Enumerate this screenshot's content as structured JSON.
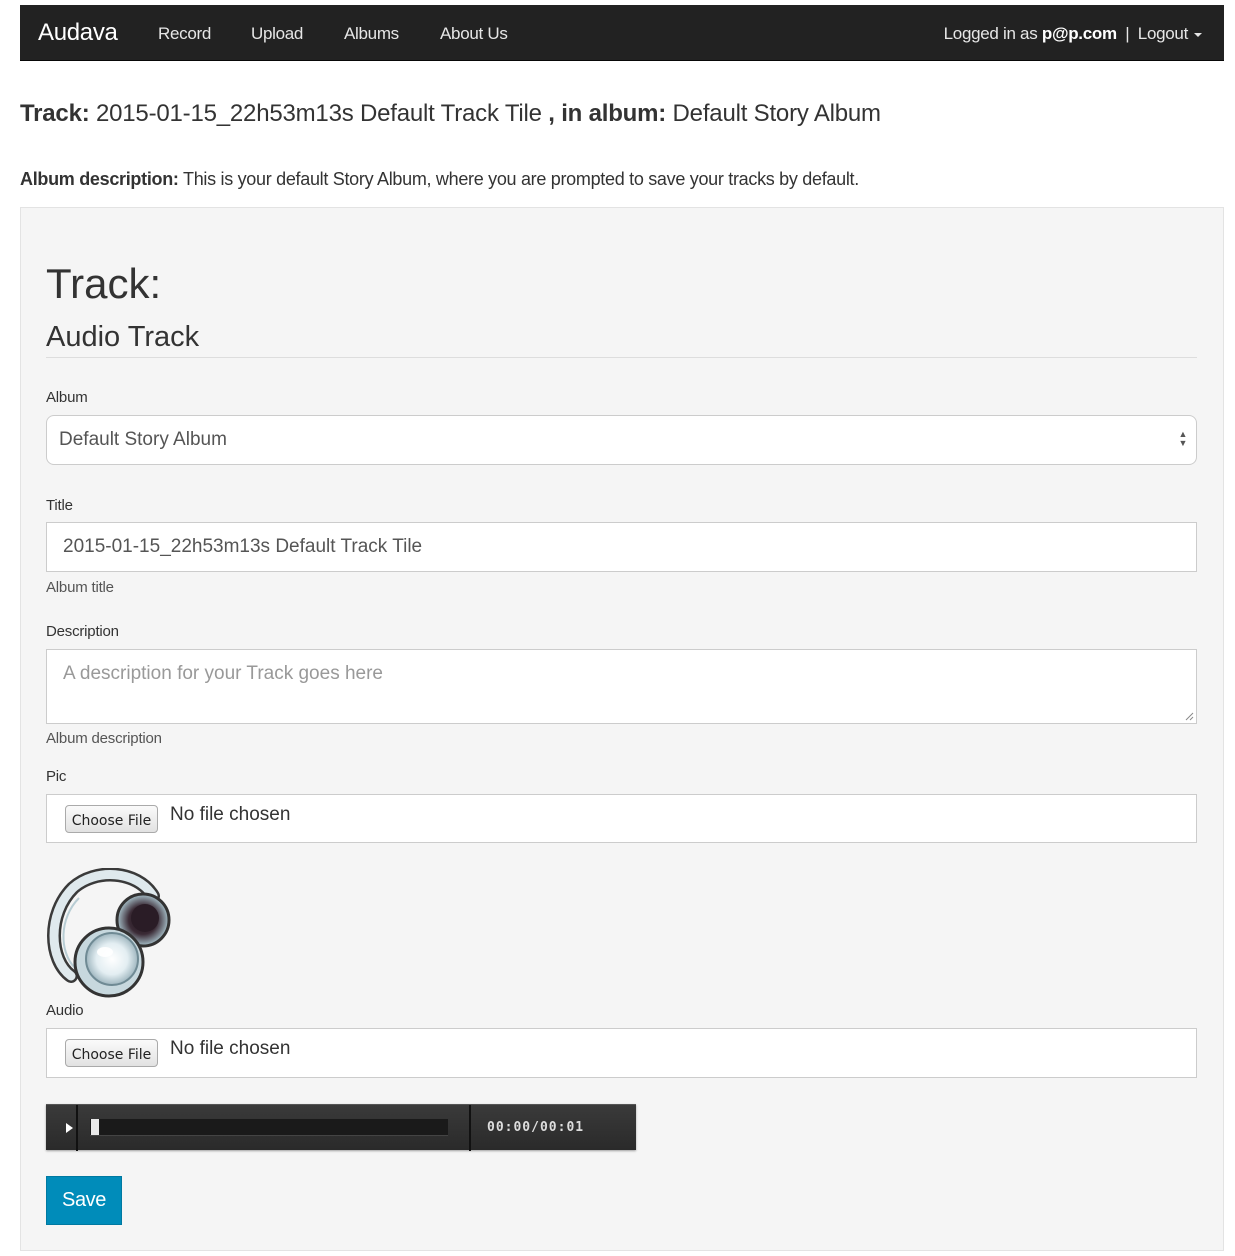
{
  "navbar": {
    "brand": "Audava",
    "links": [
      "Record",
      "Upload",
      "Albums",
      "About Us"
    ],
    "logged_in_prefix": "Logged in as",
    "user": "p@p.com",
    "separator": "|",
    "logout": "Logout"
  },
  "header": {
    "track_label": "Track:",
    "track_value": "2015-01-15_22h53m13s Default Track Tile",
    "album_label": ", in album:",
    "album_value": "Default Story Album",
    "album_desc_label": "Album description:",
    "album_desc_value": "This is your default Story Album, where you are prompted to save your tracks by default."
  },
  "form": {
    "legend": "Track:",
    "subtitle": "Audio Track",
    "album_label": "Album",
    "album_selected": "Default Story Album",
    "title_label": "Title",
    "title_value": "2015-01-15_22h53m13s Default Track Tile",
    "title_help": "Album title",
    "description_label": "Description",
    "description_placeholder": "A description for your Track goes here",
    "description_help": "Album description",
    "pic_label": "Pic",
    "pic_button": "Choose File",
    "pic_status": "No file chosen",
    "audio_label": "Audio",
    "audio_button": "Choose File",
    "audio_status": "No file chosen",
    "player_time": "00:00/00:01",
    "save": "Save"
  },
  "colors": {
    "navbar_bg": "#222222",
    "well_bg": "#f5f5f5",
    "save_button": "#008cba"
  }
}
